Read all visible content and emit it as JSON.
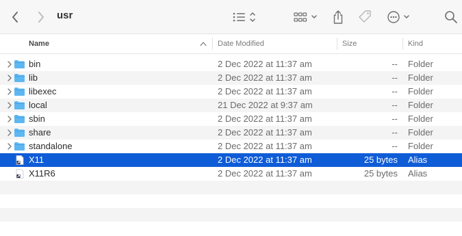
{
  "window": {
    "title": "usr"
  },
  "toolbar": {
    "back_icon": "chevron-left-icon",
    "forward_icon": "chevron-right-icon",
    "list_view_icon": "list-view-icon",
    "group_icon": "group-by-icon",
    "share_icon": "share-icon",
    "tag_icon": "tag-icon",
    "more_icon": "ellipsis-circle-icon",
    "search_icon": "search-icon"
  },
  "columns": {
    "name": "Name",
    "date": "Date Modified",
    "size": "Size",
    "kind": "Kind"
  },
  "colors": {
    "selection": "#0f5cd7",
    "folder": "#5fb7f1"
  },
  "files": [
    {
      "name": "bin",
      "date": "2 Dec 2022 at 11:37 am",
      "size": "--",
      "kind": "Folder"
    },
    {
      "name": "lib",
      "date": "2 Dec 2022 at 11:37 am",
      "size": "--",
      "kind": "Folder"
    },
    {
      "name": "libexec",
      "date": "2 Dec 2022 at 11:37 am",
      "size": "--",
      "kind": "Folder"
    },
    {
      "name": "local",
      "date": "21 Dec 2022 at 9:37 am",
      "size": "--",
      "kind": "Folder"
    },
    {
      "name": "sbin",
      "date": "2 Dec 2022 at 11:37 am",
      "size": "--",
      "kind": "Folder"
    },
    {
      "name": "share",
      "date": "2 Dec 2022 at 11:37 am",
      "size": "--",
      "kind": "Folder"
    },
    {
      "name": "standalone",
      "date": "2 Dec 2022 at 11:37 am",
      "size": "--",
      "kind": "Folder"
    },
    {
      "name": "X11",
      "date": "2 Dec 2022 at 11:37 am",
      "size": "25 bytes",
      "kind": "Alias"
    },
    {
      "name": "X11R6",
      "date": "2 Dec 2022 at 11:37 am",
      "size": "25 bytes",
      "kind": "Alias"
    }
  ]
}
